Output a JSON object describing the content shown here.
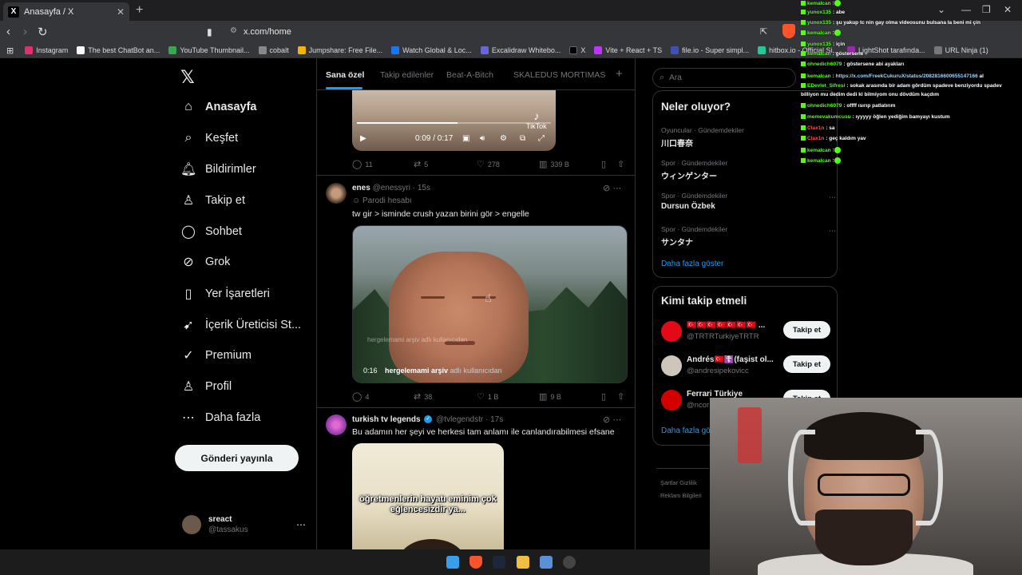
{
  "browser": {
    "tab_title": "Anasayfa / X",
    "url": "x.com/home",
    "bookmarks": [
      {
        "label": "Instagram",
        "color": "#e1306c"
      },
      {
        "label": "The best ChatBot an...",
        "color": "#ffffff"
      },
      {
        "label": "YouTube Thumbnail...",
        "color": "#34a853"
      },
      {
        "label": "cobalt",
        "color": "#888888"
      },
      {
        "label": "Jumpshare: Free File...",
        "color": "#f4b400"
      },
      {
        "label": "Watch Global & Loc...",
        "color": "#1877f2"
      },
      {
        "label": "Excalidraw Whitebo...",
        "color": "#6965db"
      },
      {
        "label": "X",
        "color": "#000000"
      },
      {
        "label": "Vite + React + TS",
        "color": "#bd34fe"
      },
      {
        "label": "file.io - Super simpl...",
        "color": "#3f51b5"
      },
      {
        "label": "hitbox.io - Official Si...",
        "color": "#20c997"
      },
      {
        "label": "LightShot tarafında...",
        "color": "#9c27b0"
      },
      {
        "label": "URL Ninja (1)",
        "color": "#777777"
      }
    ]
  },
  "nav": {
    "items": [
      {
        "label": "Anasayfa",
        "icon": "home-icon",
        "glyph": "⌂"
      },
      {
        "label": "Keşfet",
        "icon": "search-icon",
        "glyph": "⌕"
      },
      {
        "label": "Bildirimler",
        "icon": "bell-icon",
        "glyph": "♫"
      },
      {
        "label": "Takip et",
        "icon": "add-person-icon",
        "glyph": "♙"
      },
      {
        "label": "Sohbet",
        "icon": "chat-icon",
        "glyph": "◯"
      },
      {
        "label": "Grok",
        "icon": "grok-icon",
        "glyph": "⊘"
      },
      {
        "label": "Yer İşaretleri",
        "icon": "bookmark-icon",
        "glyph": "▯"
      },
      {
        "label": "İçerik Üreticisi St...",
        "icon": "rocket-icon",
        "glyph": "➹"
      },
      {
        "label": "Premium",
        "icon": "verified-icon",
        "glyph": "✓"
      },
      {
        "label": "Profil",
        "icon": "profile-icon",
        "glyph": "♙"
      },
      {
        "label": "Daha fazla",
        "icon": "more-icon",
        "glyph": "⋯"
      }
    ],
    "post_button": "Gönderi yayınla",
    "user_name": "sreact",
    "user_handle": "@tassakus"
  },
  "timeline": {
    "tabs": [
      "Sana özel",
      "Takip edilenler",
      "Beat-A-Bitch",
      "SKALEDUS MORTIMAS"
    ],
    "post1": {
      "video_time": "0:09 / 0:17",
      "tiktok_label": "TikTok",
      "replies": "11",
      "reposts": "5",
      "likes": "278",
      "views": "339 B"
    },
    "post2": {
      "name": "enes",
      "handle": "@enessyri · 15s",
      "parody": "Parodi hesabı",
      "text": "tw gir > isminde crush yazan birini gör > engelle",
      "watermark": "hergelemami arşiv adlı kullanıcıdan",
      "video_time": "0:16",
      "video_user": "hergelemami arşiv",
      "video_user_suffix": "adlı kullanıcıdan",
      "replies": "4",
      "reposts": "38",
      "likes": "1 B",
      "views": "9 B"
    },
    "post3": {
      "name": "turkish tv legends",
      "handle": "@tvlegendstr · 17s",
      "text": "Bu adamın her şeyi ve herkesi tam anlamı ile canlandırabilmesi efsane",
      "caption": "öğretmenlerin hayatı eminim çok eğlencesizdir ya..."
    }
  },
  "sidebar": {
    "search_placeholder": "Ara",
    "trends_title": "Neler oluyor?",
    "trends": [
      {
        "category": "Oyuncular · Gündemdekiler",
        "name": "川口春奈"
      },
      {
        "category": "Spor · Gündemdekiler",
        "name": "ウィンゲンター"
      },
      {
        "category": "Spor · Gündemdekiler",
        "name": "Dursun Özbek"
      },
      {
        "category": "Spor · Gündemdekiler",
        "name": "サンタナ"
      }
    ],
    "show_more": "Daha fazla göster",
    "wtf_title": "Kimi takip etmeli",
    "follow_label": "Takip et",
    "who_to_follow": [
      {
        "name": "🇹🇷🇹🇷🇹🇷🇹🇷🇹🇷🇹🇷🇹🇷 ...",
        "handle": "@TRTRTurkiyeTRTR",
        "color": "#e30a17"
      },
      {
        "name": "Andrés🇹🇷☦️(faşist ol...",
        "handle": "@andresipekovicc",
        "color": "#cfc6bb"
      },
      {
        "name": "Ferrari Türkiye",
        "handle": "@ncor",
        "color": "#d40000"
      }
    ],
    "show_more_2": "Daha fazla gö",
    "footer_1": "Şartlar   Gizlilik",
    "footer_2": "Reklam Bilgileri"
  },
  "chat": [
    {
      "user": "kemalcan",
      "color": "#53fc18",
      "msg": ":",
      "emote": true
    },
    {
      "user": "yunox135",
      "color": "#53fc18",
      "msg": ": abe"
    },
    {
      "user": "yunox135",
      "color": "#53fc18",
      "msg": ": şu yakup tc nin gay olma videosunu bulsana la beni mi çin"
    },
    {
      "user": "kemalcan",
      "color": "#53fc18",
      "msg": ":",
      "emote": true
    },
    {
      "user": "yunox135",
      "color": "#53fc18",
      "msg": ": için"
    },
    {
      "user": "kemalcan",
      "color": "#53fc18",
      "msg": ": göstersene"
    },
    {
      "user": "ohnedich6079",
      "color": "#53fc18",
      "msg": ": göstersene abi ayakları"
    },
    {
      "user": "kemalcan",
      "color": "#53fc18",
      "msg": ": ",
      "link": "https://x.com/FreekCukuruX/status/2082816600655147166",
      "tail": " al"
    },
    {
      "user": "EDevlet_Sifresi",
      "color": "#53fc18",
      "msg": ": sokak arasında bir adam gördüm spadeve benziyordu spadev"
    },
    {
      "user": "",
      "color": "#ffffff",
      "msg": "billiyon mu dedim dedi kl bilmiyom onu dövdüm kaçdım"
    },
    {
      "user": "ohnedich6079",
      "color": "#53fc18",
      "msg": ": offff ısırıp patlatırım"
    },
    {
      "user": "memevakumcusu",
      "color": "#53fc18",
      "msg": ": ıyyyyy öğlen yediğim bamyayı kustum"
    },
    {
      "user": "Clax1n",
      "color": "#ff4d4d",
      "msg": ": sa"
    },
    {
      "user": "Clax1n",
      "color": "#ff4d4d",
      "msg": ": geç kaldım yav"
    },
    {
      "user": "kemalcan",
      "color": "#53fc18",
      "msg": ":",
      "emote": true
    },
    {
      "user": "kemalcan",
      "color": "#53fc18",
      "msg": ":",
      "emote": true
    }
  ]
}
